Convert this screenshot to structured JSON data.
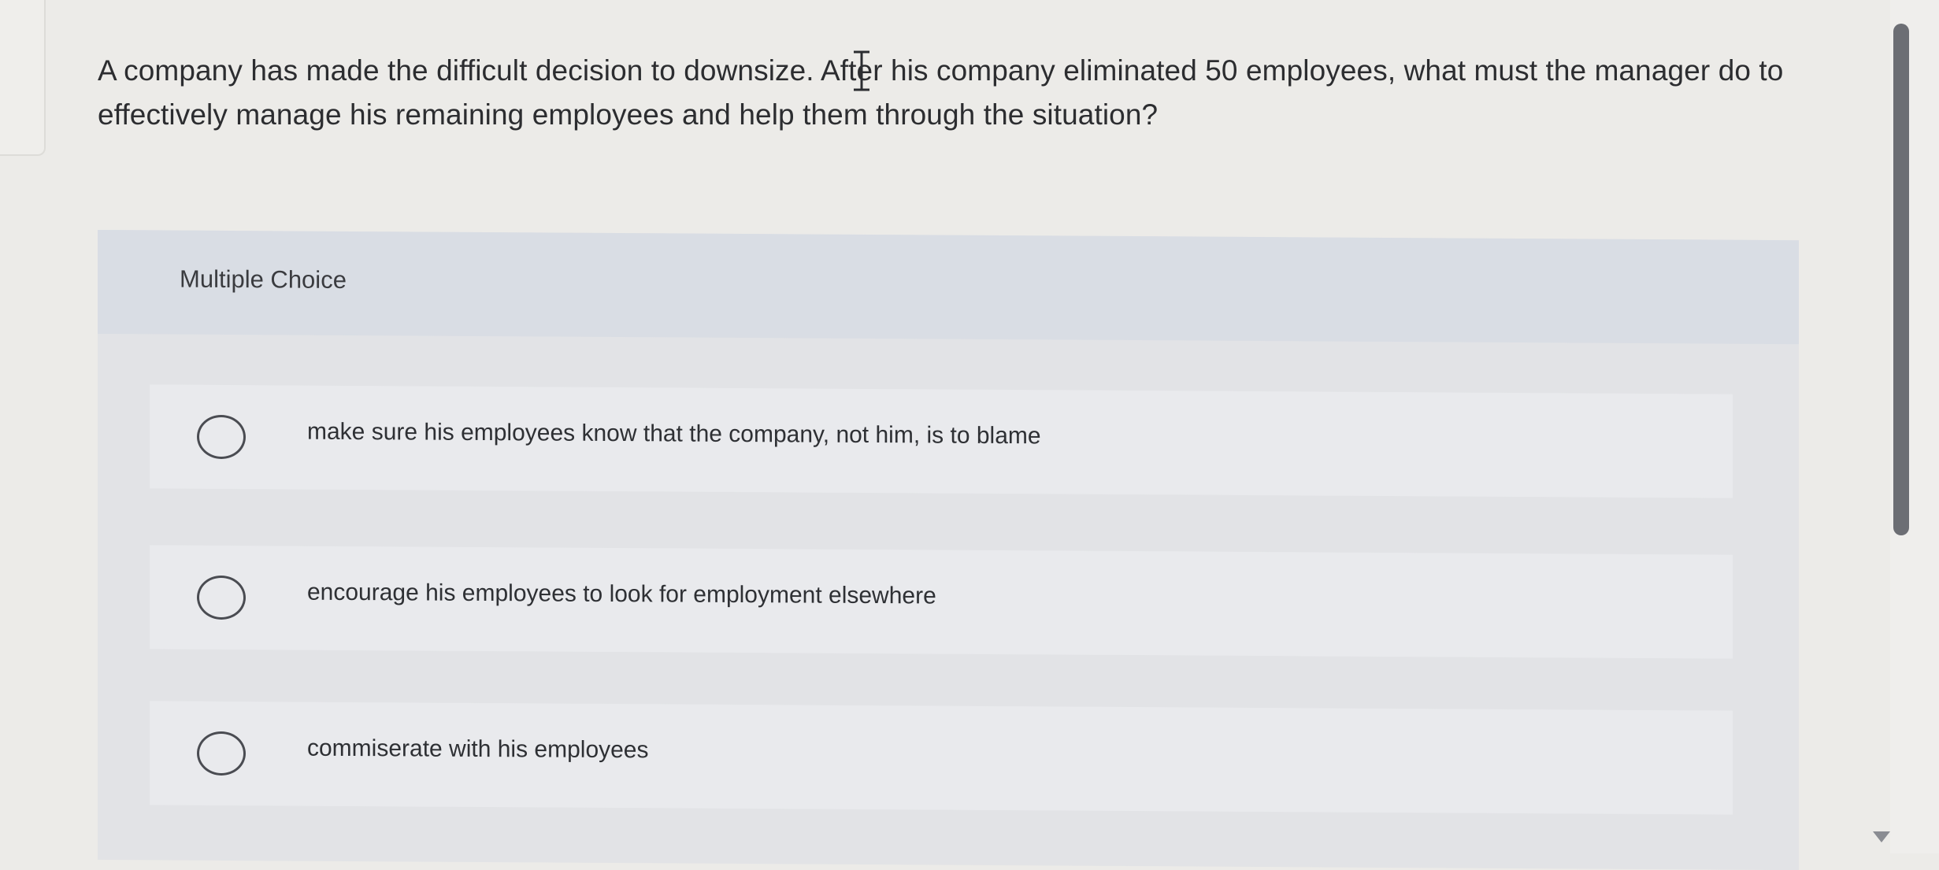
{
  "question": {
    "text": "A company has made the difficult decision to downsize. After his company eliminated 50 employees, what must the manager do to effectively manage his remaining employees and help them through the situation?"
  },
  "multiple_choice": {
    "title": "Multiple Choice",
    "options": [
      {
        "label": "make sure his employees know that the company, not him, is to blame",
        "selected": false
      },
      {
        "label": "encourage his employees to look for employment elsewhere",
        "selected": false
      },
      {
        "label": "commiserate with his employees",
        "selected": false
      }
    ]
  },
  "icons": {
    "cursor": "text-cursor-icon",
    "radio": "radio-unselected-icon",
    "scroll_down": "scroll-down-arrow-icon"
  },
  "colors": {
    "background": "#ecebe8",
    "panel": "#e2e3e6",
    "header": "#d9dde4",
    "scroll_thumb": "#6c6e74"
  }
}
